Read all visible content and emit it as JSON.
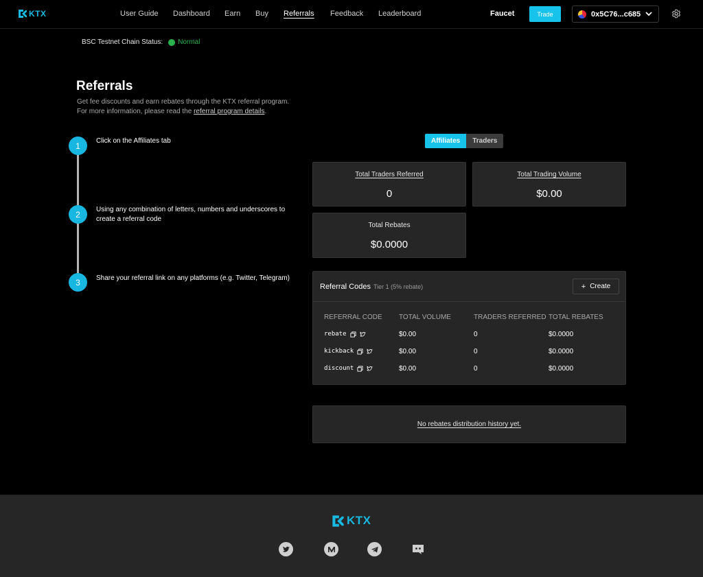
{
  "brand": {
    "name": "KTX",
    "accent": "#17c2eb"
  },
  "nav": {
    "items": [
      "User Guide",
      "Dashboard",
      "Earn",
      "Buy",
      "Referrals",
      "Feedback",
      "Leaderboard"
    ],
    "active": "Referrals",
    "faucet": "Faucet",
    "trade": "Trade",
    "wallet": "0x5C76...c685"
  },
  "chain_status": {
    "label": "BSC Testnet Chain Status:",
    "value": "Normal"
  },
  "page": {
    "title": "Referrals",
    "desc_line1": "Get fee discounts and earn rebates through the KTX referral program.",
    "desc_line2_prefix": "For more information, please read the ",
    "desc_link": "referral program details",
    "desc_line2_suffix": "."
  },
  "steps": [
    {
      "num": "1",
      "text": "Click on the Affiliates tab"
    },
    {
      "num": "2",
      "text": "Using any combination of letters, numbers and underscores to create a referral code"
    },
    {
      "num": "3",
      "text": "Share your referral link on any platforms (e.g. Twitter, Telegram)"
    }
  ],
  "tabs": {
    "affiliates": "Affiliates",
    "traders": "Traders"
  },
  "stats": {
    "traders_referred": {
      "label": "Total Traders Referred",
      "value": "0"
    },
    "trading_volume": {
      "label": "Total Trading Volume",
      "value": "$0.00"
    },
    "rebates": {
      "label": "Total Rebates",
      "value": "$0.0000"
    }
  },
  "codes": {
    "title": "Referral Codes",
    "tier": "Tier 1 (5% rebate)",
    "create": "Create",
    "columns": [
      "REFERRAL CODE",
      "TOTAL VOLUME",
      "TRADERS REFERRED",
      "TOTAL REBATES"
    ],
    "rows": [
      {
        "code": "rebate",
        "volume": "$0.00",
        "traders": "0",
        "rebates": "$0.0000"
      },
      {
        "code": "kickback",
        "volume": "$0.00",
        "traders": "0",
        "rebates": "$0.0000"
      },
      {
        "code": "discount",
        "volume": "$0.00",
        "traders": "0",
        "rebates": "$0.0000"
      }
    ]
  },
  "history": {
    "empty": "No rebates distribution history yet."
  },
  "footer": {
    "brand": "KTX",
    "socials": [
      "twitter-icon",
      "medium-icon",
      "telegram-icon",
      "discord-icon"
    ]
  }
}
